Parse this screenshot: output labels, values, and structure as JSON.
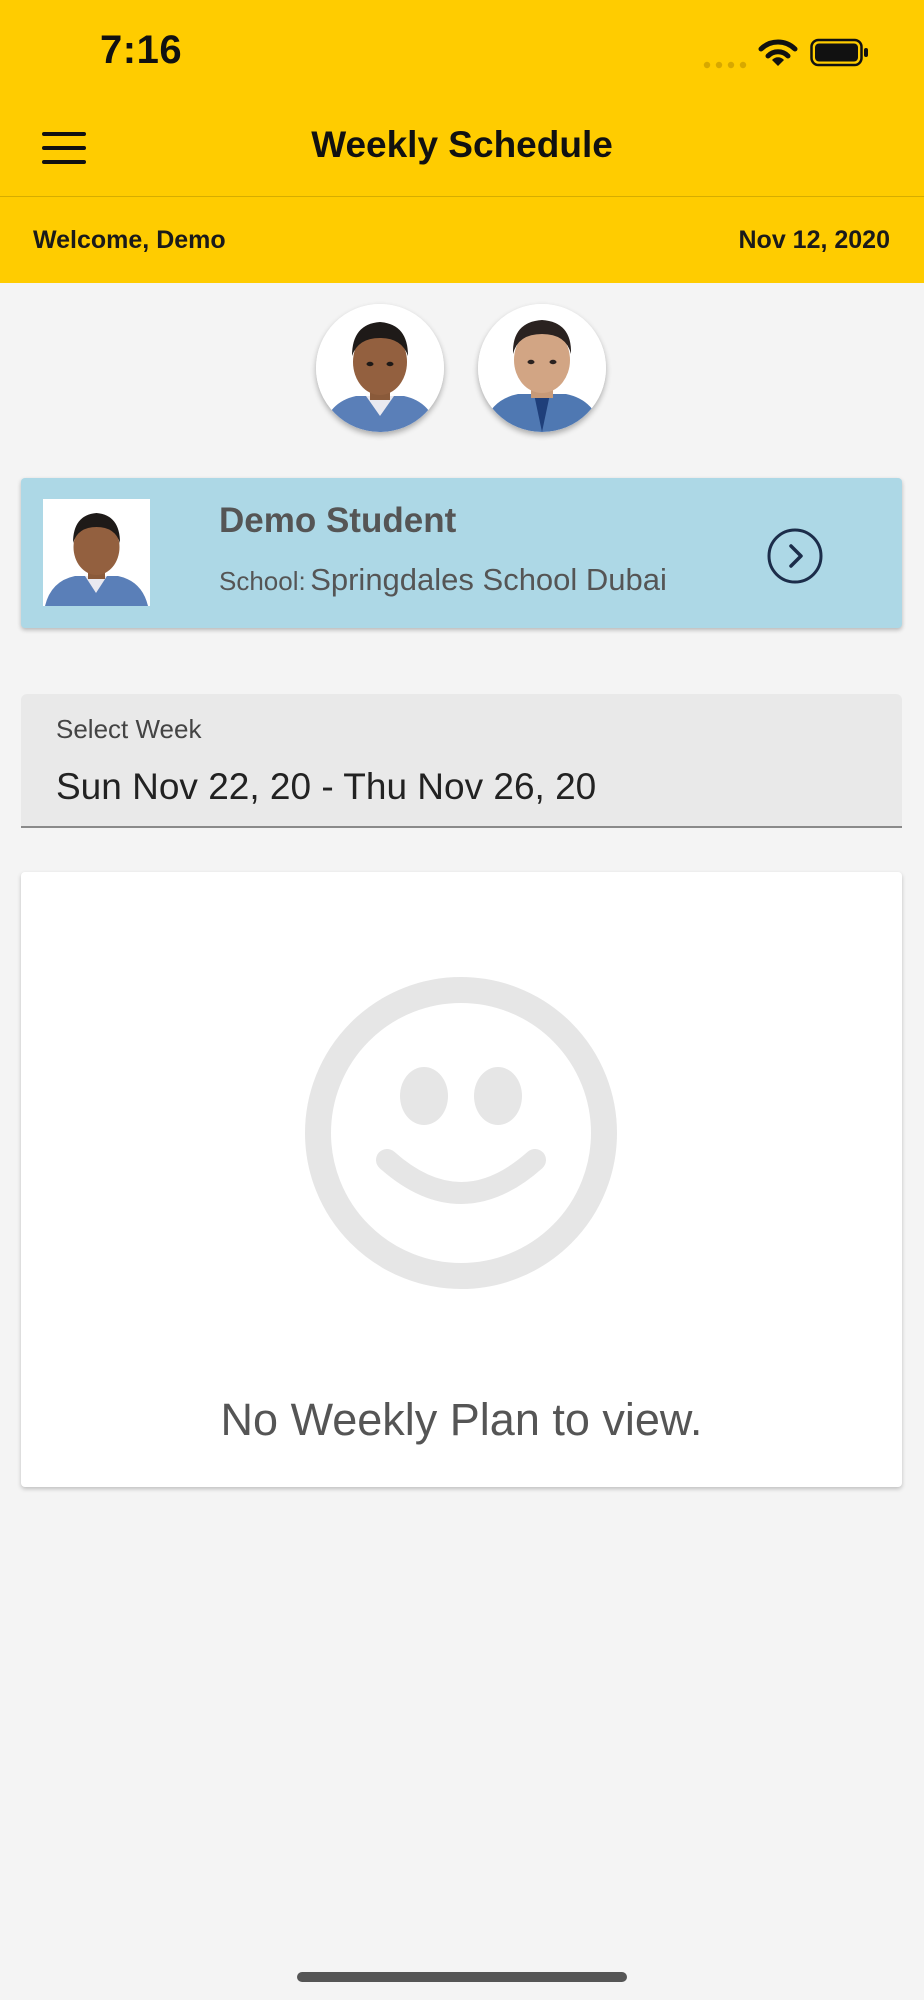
{
  "status_bar": {
    "time": "7:16",
    "icons": [
      "signal-icon",
      "wifi-icon",
      "battery-icon"
    ]
  },
  "header": {
    "title": "Weekly Schedule",
    "menu_icon": "menu-icon"
  },
  "welcome_bar": {
    "welcome": "Welcome, Demo",
    "date": "Nov 12, 2020"
  },
  "student_card": {
    "name": "Demo Student",
    "school_label": "School:",
    "school_name": "Springdales School Dubai",
    "arrow_icon": "chevron-right-circle-icon"
  },
  "week_select": {
    "label": "Select Week",
    "value": "Sun Nov 22, 20 - Thu Nov 26, 20"
  },
  "empty_state": {
    "icon": "smiley-icon",
    "message": "No Weekly Plan to view."
  },
  "colors": {
    "accent": "#ffcc00",
    "card": "#add8e6",
    "background": "#f4f4f4",
    "placeholder_icon": "#e6e6e6",
    "arrow": "#1c2d4a"
  }
}
